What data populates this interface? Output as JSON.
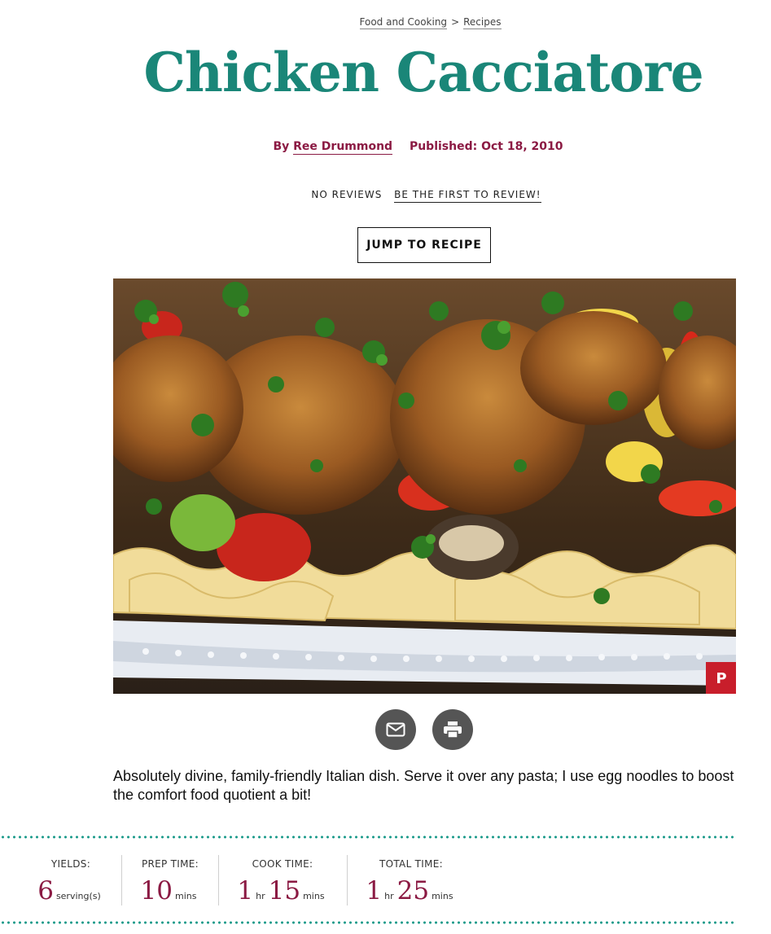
{
  "breadcrumb": {
    "section": "Food and Cooking",
    "separator": ">",
    "current": "Recipes"
  },
  "title": "Chicken Cacciatore",
  "byline": {
    "by": "By",
    "author": "Ree Drummond",
    "published": "Published: Oct 18, 2010"
  },
  "reviews": {
    "status": "NO REVIEWS",
    "cta": "BE THE FIRST TO REVIEW!"
  },
  "jump_button": "JUMP TO RECIPE",
  "share": {
    "email_icon": "envelope-icon",
    "print_icon": "printer-icon",
    "pinterest_icon": "pinterest-icon",
    "pin_letter": "P"
  },
  "description": "Absolutely divine, family-friendly Italian dish. Serve it over any pasta; I use egg noodles to boost the comfort food quotient a bit!",
  "stats": {
    "yields": {
      "label": "YIELDS:",
      "num": "6",
      "unit": "serving(s)"
    },
    "prep": {
      "label": "PREP TIME:",
      "num": "10",
      "unit": "mins"
    },
    "cook": {
      "label": "COOK TIME:",
      "hr": "1",
      "hr_unit": "hr",
      "min": "15",
      "min_unit": "mins"
    },
    "total": {
      "label": "TOTAL TIME:",
      "hr": "1",
      "hr_unit": "hr",
      "min": "25",
      "min_unit": "mins"
    }
  },
  "colors": {
    "title": "#1a8678",
    "accent": "#8b1a43",
    "dots": "#1a9a8a",
    "pin": "#c81e2b"
  }
}
